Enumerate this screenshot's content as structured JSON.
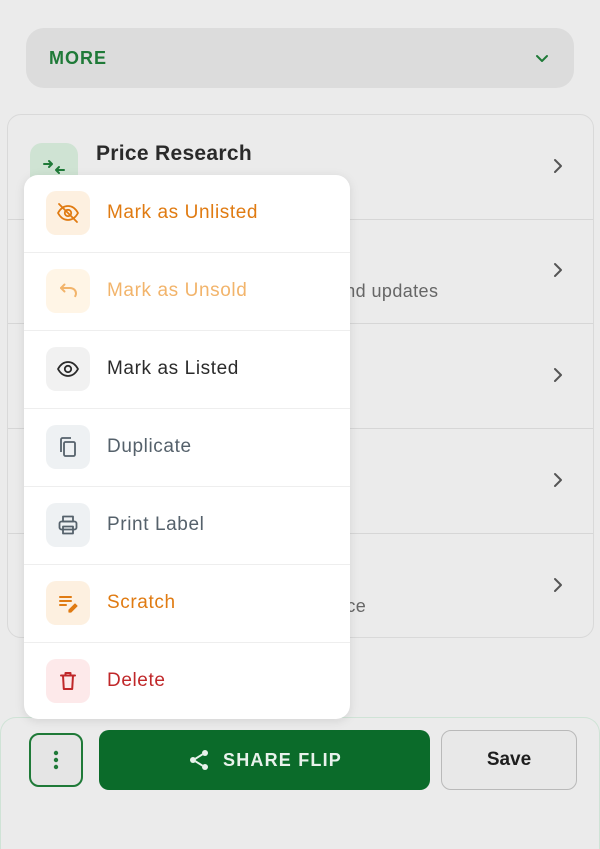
{
  "header": {
    "more_label": "MORE",
    "chevron_icon": "chevron-down-icon"
  },
  "list": {
    "rows": [
      {
        "title": "Price Research",
        "subtitle": "",
        "icon": "swap-arrows-icon"
      },
      {
        "title": "",
        "subtitle": "y, and updates",
        "icon": ""
      },
      {
        "title": "",
        "subtitle": "",
        "icon": ""
      },
      {
        "title": "",
        "subtitle": "",
        "icon": ""
      },
      {
        "title": "",
        "subtitle": "nce",
        "icon": ""
      }
    ]
  },
  "menu": {
    "items": [
      {
        "label": "Mark as Unlisted",
        "icon": "eye-off-icon",
        "color": "#e07b12",
        "bg": "#fdf0e0"
      },
      {
        "label": "Mark as Unsold",
        "icon": "undo-icon",
        "color": "#f2b46b",
        "bg": "#fff5e6"
      },
      {
        "label": "Mark as Listed",
        "icon": "eye-icon",
        "color": "#2b2b2b",
        "bg": "#f1f1f1"
      },
      {
        "label": "Duplicate",
        "icon": "copy-icon",
        "color": "#55616b",
        "bg": "#eef1f3"
      },
      {
        "label": "Print Label",
        "icon": "printer-icon",
        "color": "#55616b",
        "bg": "#eef1f3"
      },
      {
        "label": "Scratch",
        "icon": "edit-note-icon",
        "color": "#e07b12",
        "bg": "#fdf0e0"
      },
      {
        "label": "Delete",
        "icon": "trash-icon",
        "color": "#c0282a",
        "bg": "#fde9ea"
      }
    ]
  },
  "actions": {
    "share_label": "SHARE FLIP",
    "save_label": "Save",
    "more_icon": "kebab-icon",
    "share_icon": "share-icon"
  },
  "colors": {
    "brand_green": "#0b6b2a",
    "accent_green": "#1f7a38"
  }
}
